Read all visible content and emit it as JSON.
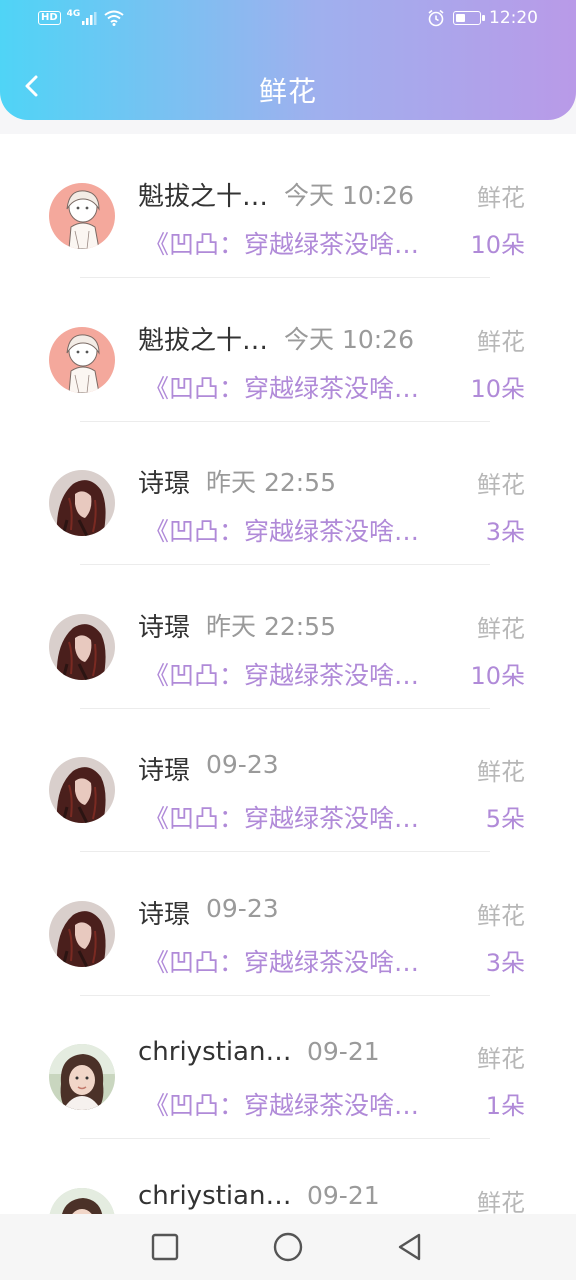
{
  "status": {
    "network": "4G",
    "hd": "HD",
    "time": "12:20",
    "battery_level": 0.4
  },
  "header": {
    "title": "鲜花"
  },
  "colors": {
    "gradient_start": "#4fd4f6",
    "gradient_end": "#b99ae8",
    "accent_purple": "#b08ad8"
  },
  "records": [
    {
      "name": "魁拔之十…",
      "time": "今天 10:26",
      "label": "鲜花",
      "book": "《凹凸：穿越绿茶没啥…",
      "count": "10朵",
      "avatar": "anime-girl"
    },
    {
      "name": "魁拔之十…",
      "time": "今天 10:26",
      "label": "鲜花",
      "book": "《凹凸：穿越绿茶没啥…",
      "count": "10朵",
      "avatar": "anime-girl"
    },
    {
      "name": "诗璟",
      "time": "昨天 22:55",
      "label": "鲜花",
      "book": "《凹凸：穿越绿茶没啥…",
      "count": "3朵",
      "avatar": "dark-portrait"
    },
    {
      "name": "诗璟",
      "time": "昨天 22:55",
      "label": "鲜花",
      "book": "《凹凸：穿越绿茶没啥…",
      "count": "10朵",
      "avatar": "dark-portrait"
    },
    {
      "name": "诗璟",
      "time": "09-23",
      "label": "鲜花",
      "book": "《凹凸：穿越绿茶没啥…",
      "count": "5朵",
      "avatar": "dark-portrait"
    },
    {
      "name": "诗璟",
      "time": "09-23",
      "label": "鲜花",
      "book": "《凹凸：穿越绿茶没啥…",
      "count": "3朵",
      "avatar": "dark-portrait"
    },
    {
      "name": "chriystian…",
      "time": "09-21",
      "label": "鲜花",
      "book": "《凹凸：穿越绿茶没啥…",
      "count": "1朵",
      "avatar": "photo-girl"
    },
    {
      "name": "chriystian…",
      "time": "09-21",
      "label": "鲜花",
      "book": "",
      "count": "",
      "avatar": "photo-girl"
    }
  ],
  "navbar": {
    "icons": [
      "square-recents-icon",
      "circle-home-icon",
      "triangle-back-icon"
    ]
  }
}
